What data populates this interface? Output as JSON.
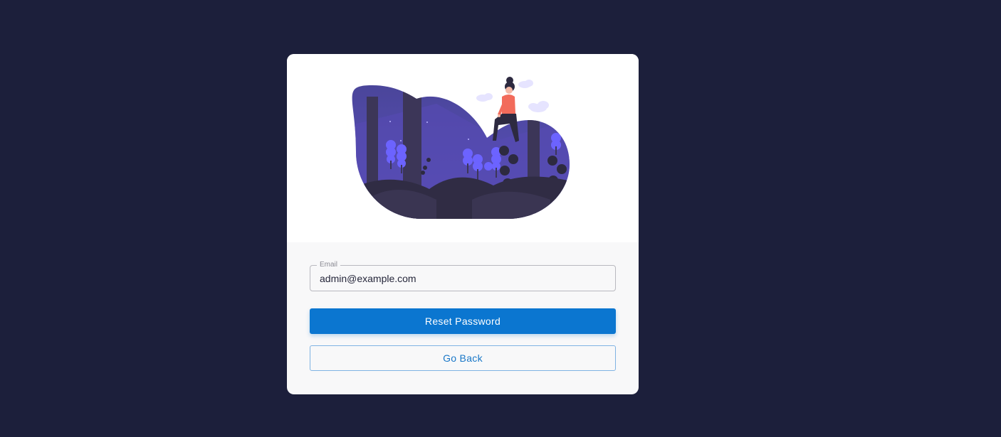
{
  "illustration": {
    "icon": "forest-night-woman-illustration",
    "colors": {
      "sky": "#5048a8",
      "ground": "#302c44",
      "trees": "#6c63ff",
      "person_shirt": "#f26b5b"
    }
  },
  "form": {
    "email": {
      "label": "Email",
      "value": "admin@example.com"
    },
    "reset_button": "Reset Password",
    "back_button": "Go Back"
  },
  "colors": {
    "background": "#1c1f3b",
    "primary": "#0b76d0"
  }
}
